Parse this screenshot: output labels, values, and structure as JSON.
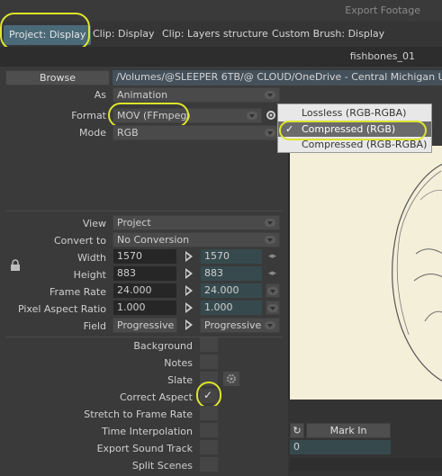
{
  "window": {
    "title": "Export Footage"
  },
  "tabs": [
    {
      "label": "Project: Display"
    },
    {
      "label": "Clip: Display"
    },
    {
      "label": "Clip: Layers structure"
    },
    {
      "label": "Custom Brush: Display"
    }
  ],
  "footage": {
    "name": "fishbones_01"
  },
  "browse": {
    "button_label": "Browse",
    "path": "/Volumes/@SLEEPER 6TB/@ CLOUD/OneDrive - Central Michigan Univer"
  },
  "fields": {
    "as": {
      "label": "As",
      "value": "Animation"
    },
    "format": {
      "label": "Format",
      "value": "MOV (FFmpeg)"
    },
    "mode": {
      "label": "Mode",
      "value": "RGB"
    },
    "view": {
      "label": "View",
      "value": "Project"
    },
    "convert": {
      "label": "Convert to",
      "value": "No Conversion"
    },
    "width": {
      "label": "Width",
      "src": "1570",
      "dst": "1570"
    },
    "height": {
      "label": "Height",
      "src": "883",
      "dst": "883"
    },
    "frame_rate": {
      "label": "Frame Rate",
      "src": "24.000",
      "dst": "24.000"
    },
    "pixel_aspect": {
      "label": "Pixel Aspect Ratio",
      "src": "1.000",
      "dst": "1.000"
    },
    "field": {
      "label": "Field",
      "src": "Progressive",
      "dst": "Progressive"
    }
  },
  "format_dropdown": {
    "options": [
      "Lossless (RGB-RGBA)",
      "Compressed (RGB)",
      "Compressed (RGB-RGBA)"
    ],
    "selected": "Compressed (RGB)"
  },
  "options": [
    {
      "label": "Background",
      "checked": false
    },
    {
      "label": "Notes",
      "checked": false
    },
    {
      "label": "Slate",
      "checked": false
    },
    {
      "label": "Correct Aspect",
      "checked": true
    },
    {
      "label": "Stretch to Frame Rate",
      "checked": false
    },
    {
      "label": "Time Interpolation",
      "checked": false
    },
    {
      "label": "Export Sound Track",
      "checked": false
    },
    {
      "label": "Split Scenes",
      "checked": false
    }
  ],
  "timeline": {
    "mark_in_label": "Mark In",
    "mark_in_value": "0"
  },
  "colors": {
    "highlight": "#dde52b",
    "accent_tab": "#4b6a78",
    "path_bg": "#44505a"
  }
}
